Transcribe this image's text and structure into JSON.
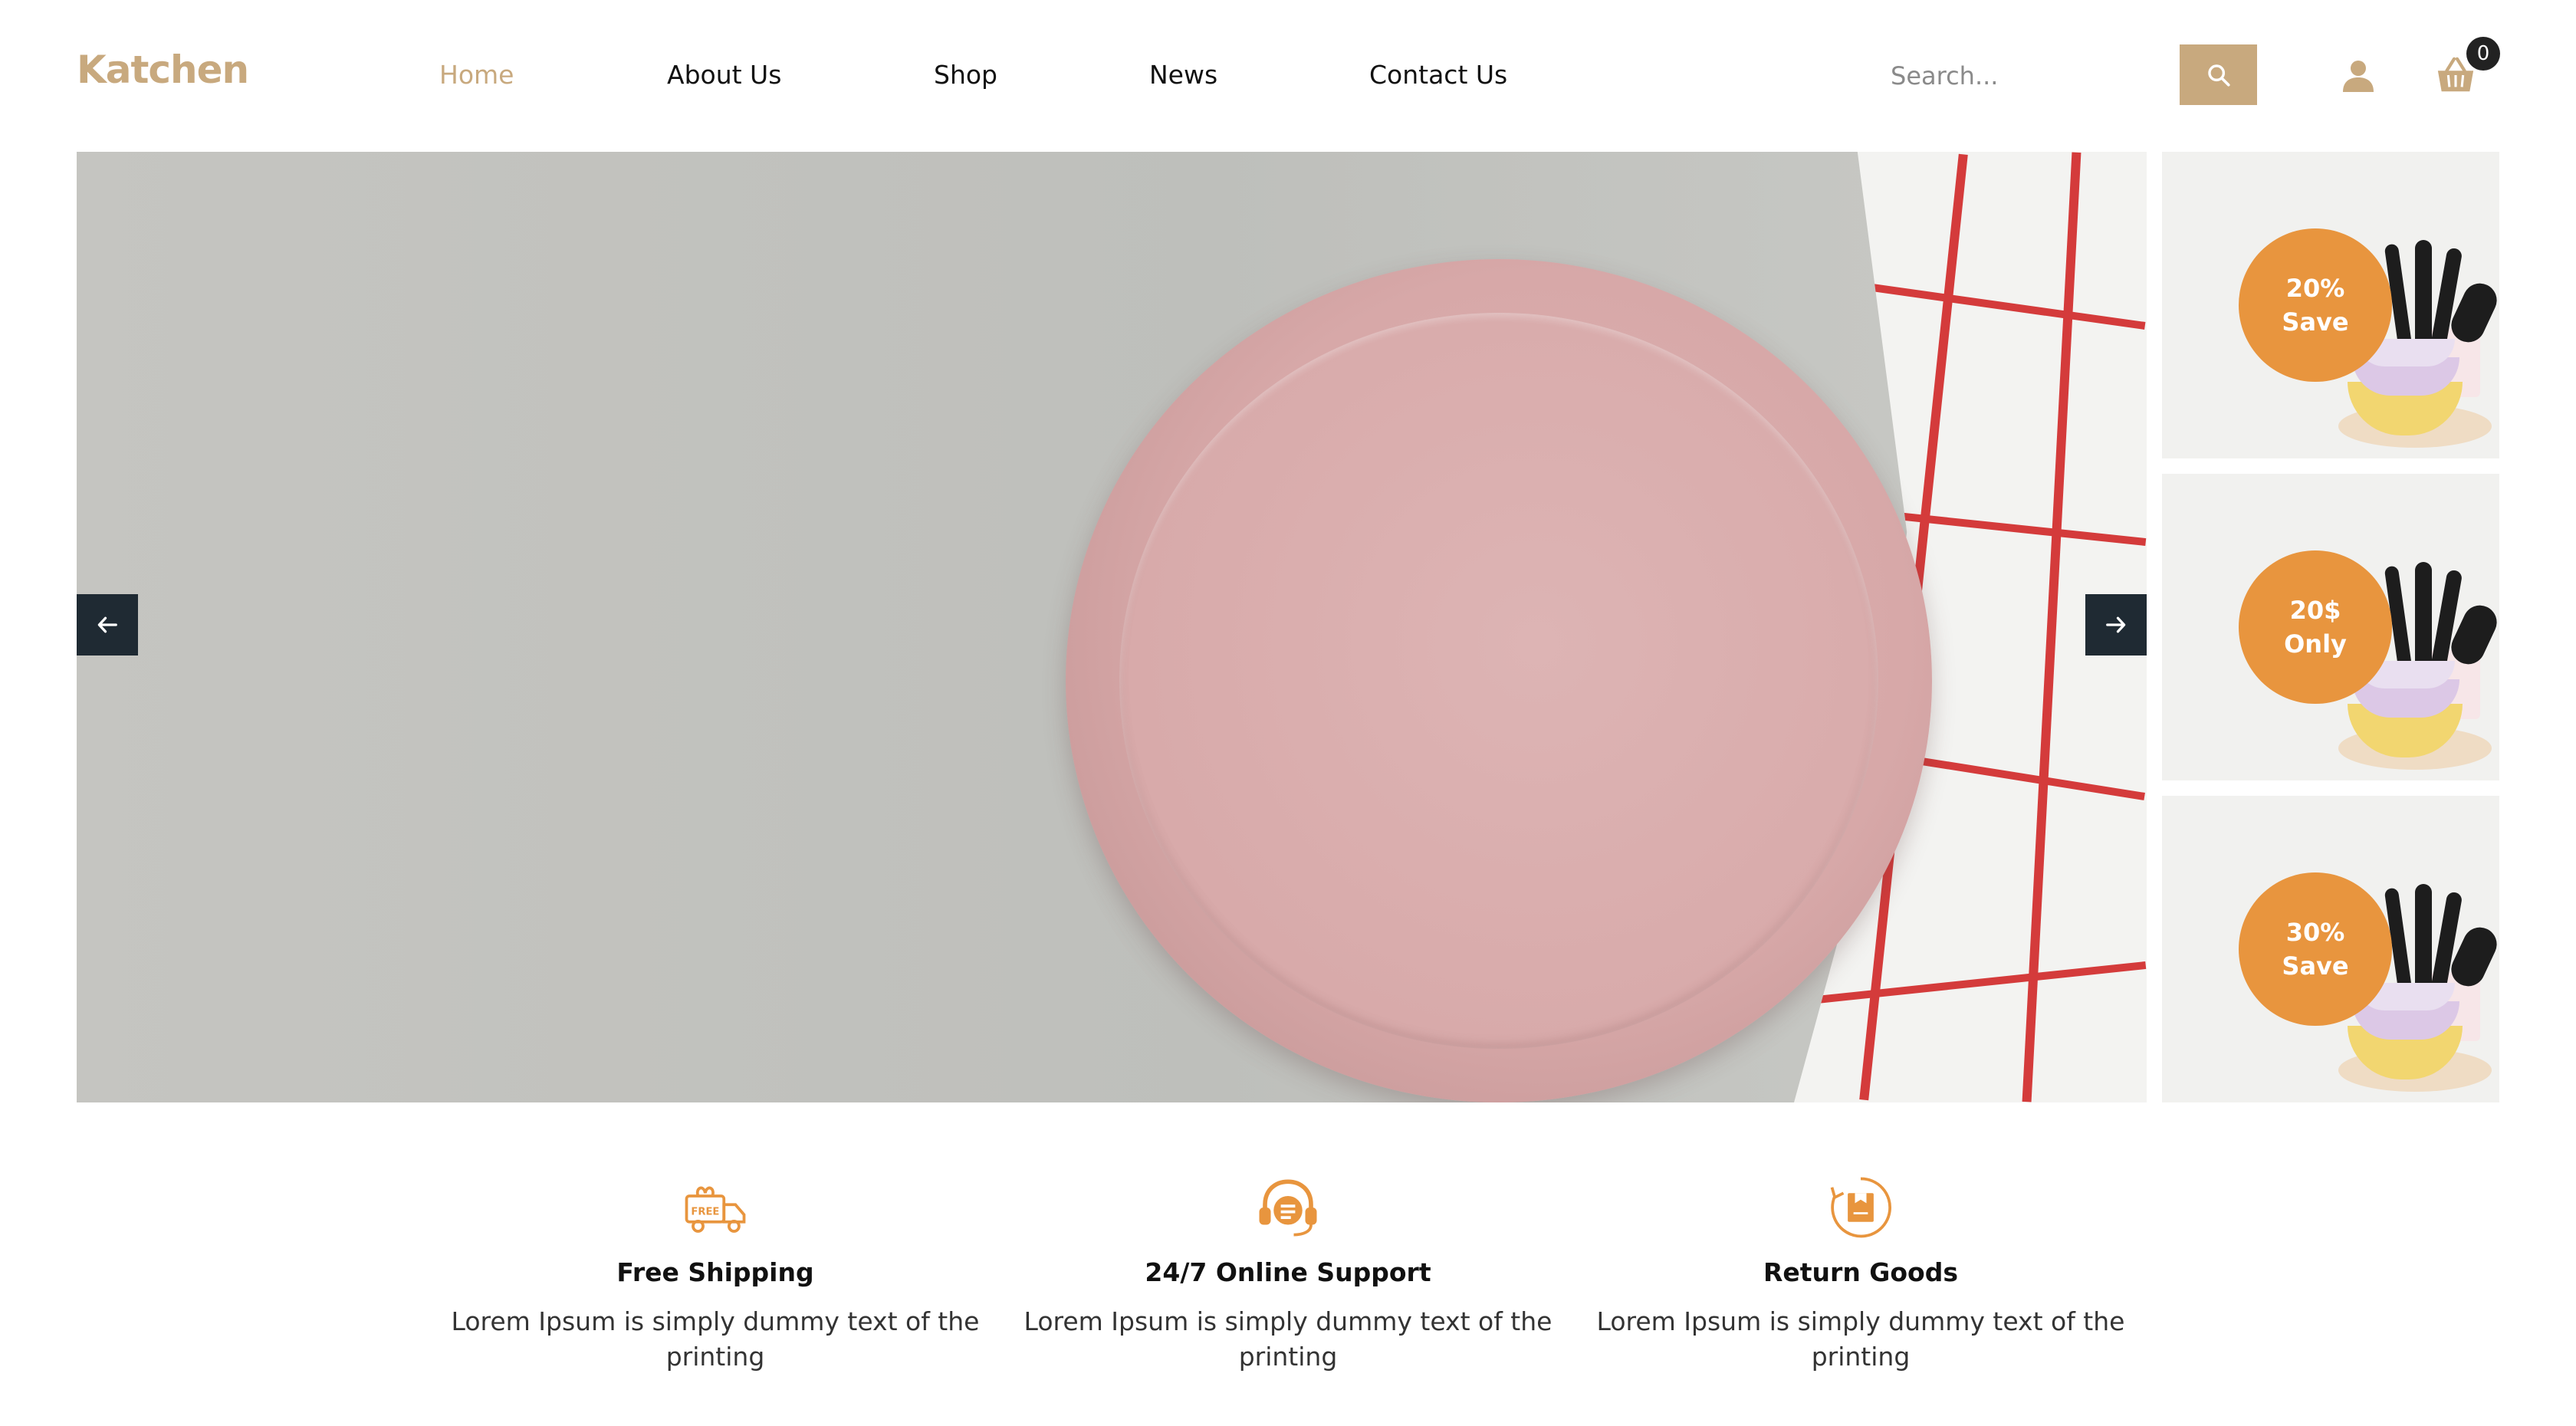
{
  "brand": {
    "name": "Katchen",
    "accent": "#c8a97e",
    "promo_color": "#e8953e"
  },
  "nav": {
    "items": [
      {
        "label": "Home",
        "active": true
      },
      {
        "label": "About Us",
        "active": false
      },
      {
        "label": "Shop",
        "active": false
      },
      {
        "label": "News",
        "active": false
      },
      {
        "label": "Contact Us",
        "active": false
      }
    ]
  },
  "search": {
    "placeholder": "Search...",
    "icon": "search-icon"
  },
  "header_icons": {
    "user": "user-icon",
    "cart": "basket-icon"
  },
  "cart": {
    "count": "0"
  },
  "hero": {
    "prev_icon": "arrow-left-icon",
    "next_icon": "arrow-right-icon"
  },
  "promos": [
    {
      "line1": "20%",
      "line2": "Save"
    },
    {
      "line1": "20$",
      "line2": "Only"
    },
    {
      "line1": "30%",
      "line2": "Save"
    }
  ],
  "features": [
    {
      "icon": "free-shipping-truck-icon",
      "title": "Free Shipping",
      "desc": "Lorem Ipsum is simply dummy text of the printing"
    },
    {
      "icon": "headset-support-icon",
      "title": "24/7 Online Support",
      "desc": "Lorem Ipsum is simply dummy text of the printing"
    },
    {
      "icon": "return-box-icon",
      "title": "Return Goods",
      "desc": "Lorem Ipsum is simply dummy text of the printing"
    }
  ]
}
